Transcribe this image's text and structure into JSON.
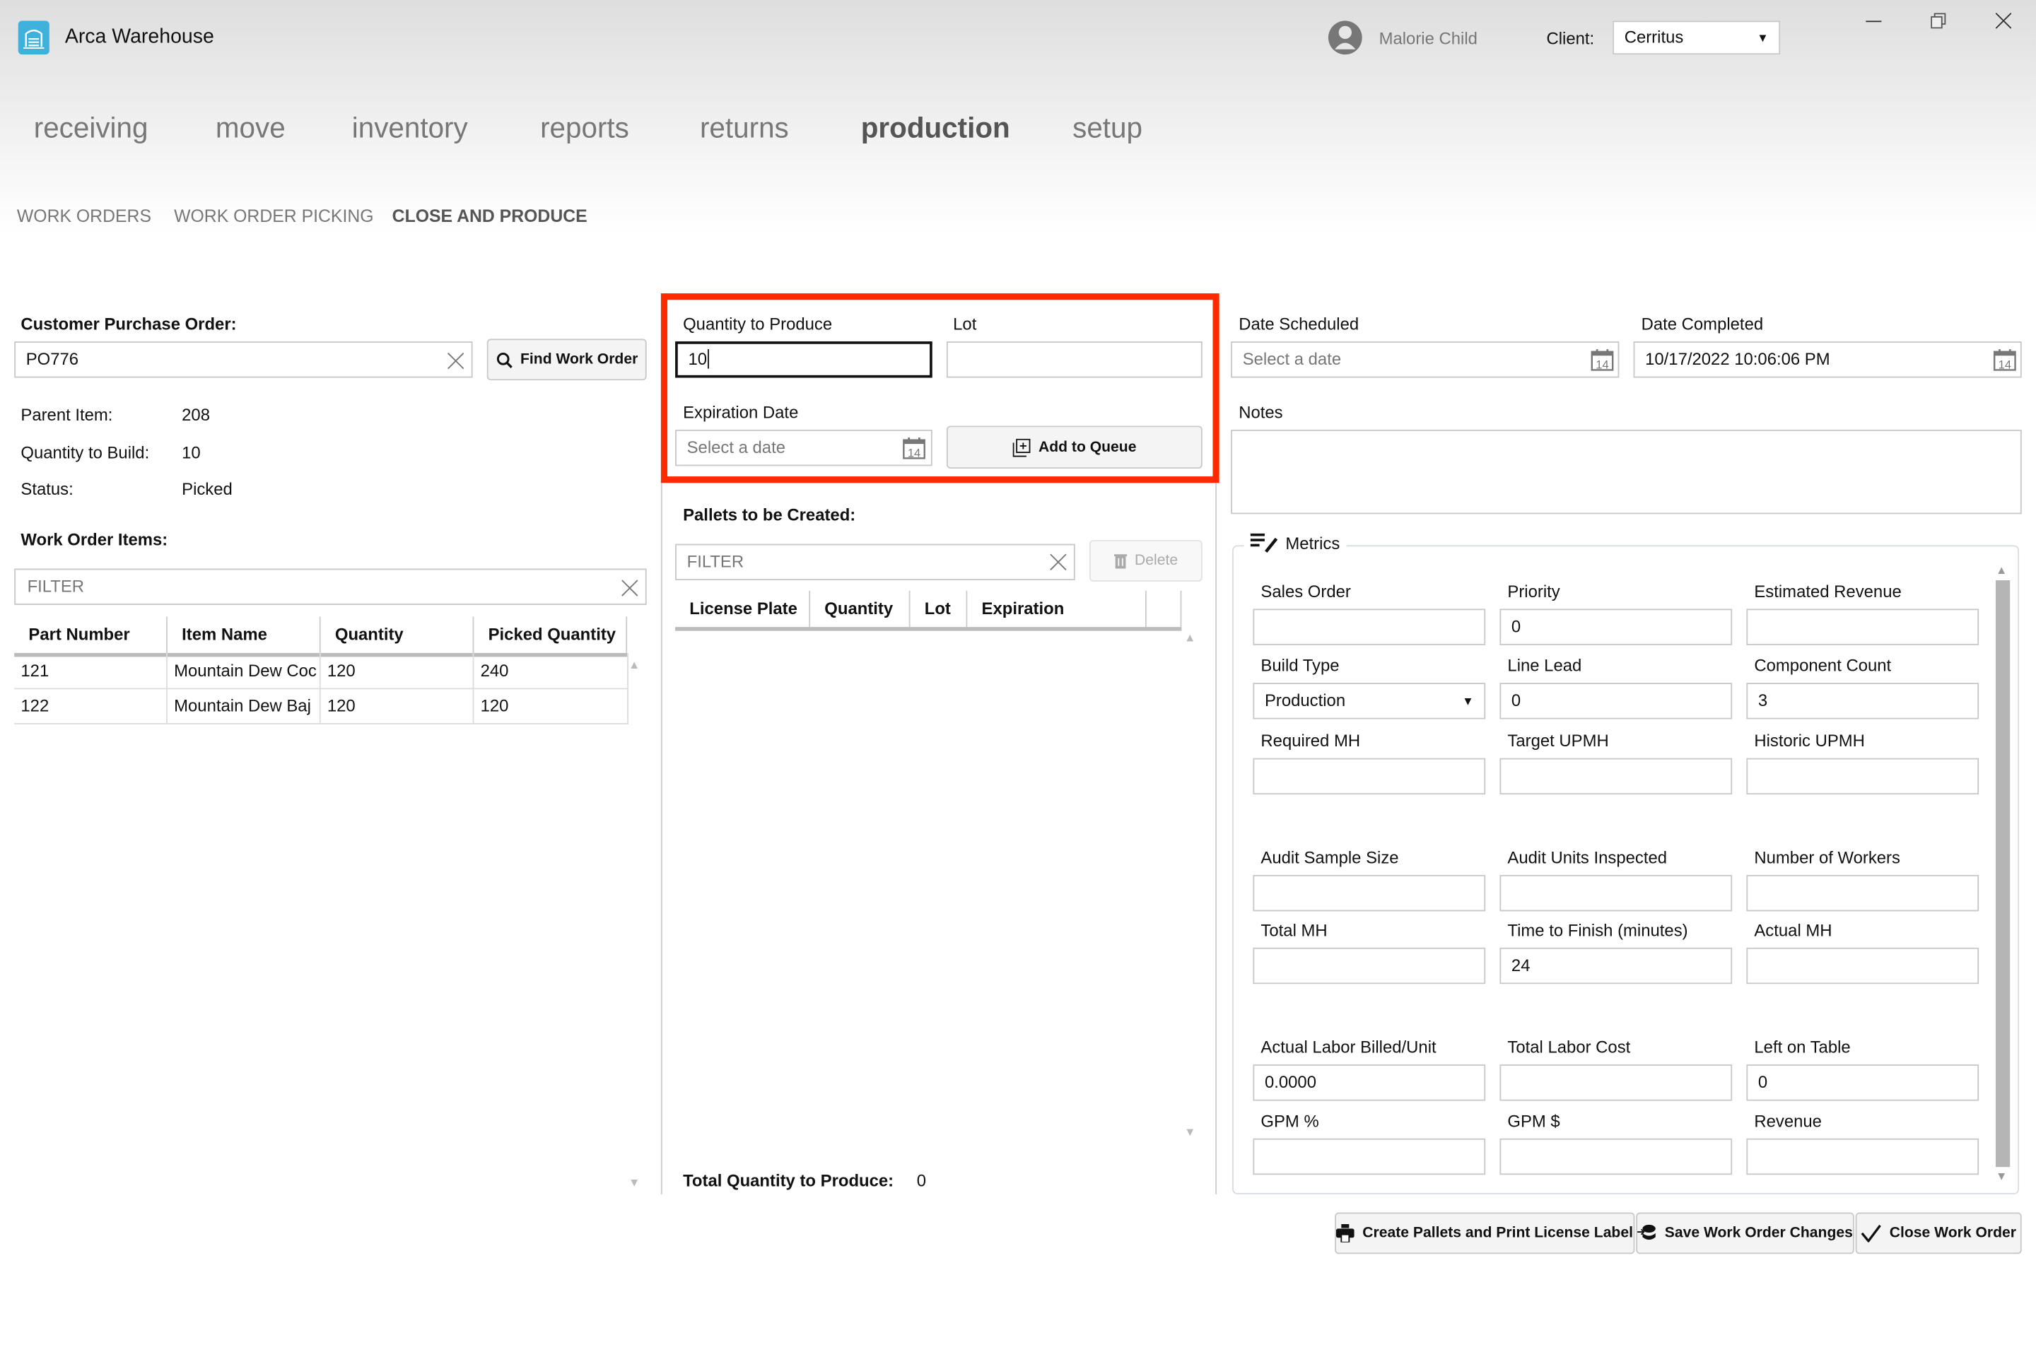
{
  "app": {
    "title": "Arca Warehouse",
    "user": "Malorie Child",
    "client_label": "Client:",
    "client_value": "Cerritus"
  },
  "nav": {
    "items": [
      "receiving",
      "move",
      "inventory",
      "reports",
      "returns",
      "production",
      "setup"
    ],
    "active": "production"
  },
  "subnav": {
    "items": [
      "WORK ORDERS",
      "WORK ORDER PICKING",
      "CLOSE AND PRODUCE"
    ],
    "active": "CLOSE AND PRODUCE"
  },
  "left": {
    "po_label": "Customer Purchase Order:",
    "po_value": "PO776",
    "find_button": "Find Work Order",
    "parent_item_label": "Parent Item:",
    "parent_item_value": "208",
    "qty_build_label": "Quantity to Build:",
    "qty_build_value": "10",
    "status_label": "Status:",
    "status_value": "Picked",
    "items_label": "Work Order Items:",
    "filter_placeholder": "FILTER",
    "columns": [
      "Part Number",
      "Item Name",
      "Quantity",
      "Picked Quantity"
    ],
    "rows": [
      [
        "121",
        "Mountain Dew Coc",
        "120",
        "240"
      ],
      [
        "122",
        "Mountain Dew Baj",
        "120",
        "120"
      ]
    ]
  },
  "middle": {
    "qty_produce_label": "Quantity to Produce",
    "qty_produce_value": "10",
    "lot_label": "Lot",
    "lot_value": "",
    "exp_label": "Expiration Date",
    "exp_placeholder": "Select a date",
    "add_queue_button": "Add to Queue",
    "pallets_label": "Pallets to be Created:",
    "filter_placeholder": "FILTER",
    "delete_button": "Delete",
    "columns": [
      "License Plate",
      "Quantity",
      "Lot",
      "Expiration"
    ],
    "total_label": "Total Quantity to Produce:",
    "total_value": "0",
    "highlight_color": "#ff2a00"
  },
  "right": {
    "date_scheduled_label": "Date Scheduled",
    "date_scheduled_placeholder": "Select a date",
    "date_completed_label": "Date Completed",
    "date_completed_value": "10/17/2022 10:06:06 PM",
    "notes_label": "Notes",
    "notes_value": "",
    "metrics_label": "Metrics",
    "metrics": [
      {
        "label": "Sales Order",
        "value": ""
      },
      {
        "label": "Priority",
        "value": "0"
      },
      {
        "label": "Estimated Revenue",
        "value": ""
      },
      {
        "label": "Build Type",
        "value": "Production",
        "dropdown": true
      },
      {
        "label": "Line Lead",
        "value": "0"
      },
      {
        "label": "Component Count",
        "value": "3"
      },
      {
        "label": "Required MH",
        "value": ""
      },
      {
        "label": "Target UPMH",
        "value": ""
      },
      {
        "label": "Historic UPMH",
        "value": ""
      },
      {
        "label": "Audit Sample Size",
        "value": ""
      },
      {
        "label": "Audit Units Inspected",
        "value": ""
      },
      {
        "label": "Number of Workers",
        "value": ""
      },
      {
        "label": "Total MH",
        "value": ""
      },
      {
        "label": "Time to Finish (minutes)",
        "value": "24"
      },
      {
        "label": "Actual MH",
        "value": ""
      },
      {
        "label": "Actual Labor Billed/Unit",
        "value": "0.0000"
      },
      {
        "label": "Total Labor Cost",
        "value": ""
      },
      {
        "label": "Left on Table",
        "value": "0"
      },
      {
        "label": "GPM %",
        "value": ""
      },
      {
        "label": "GPM $",
        "value": ""
      },
      {
        "label": "Revenue",
        "value": ""
      }
    ]
  },
  "footer": {
    "create_pallets_button": "Create Pallets and Print License Label",
    "save_button": "Save Work Order Changes",
    "close_button": "Close Work Order"
  },
  "calendar_day": "14"
}
